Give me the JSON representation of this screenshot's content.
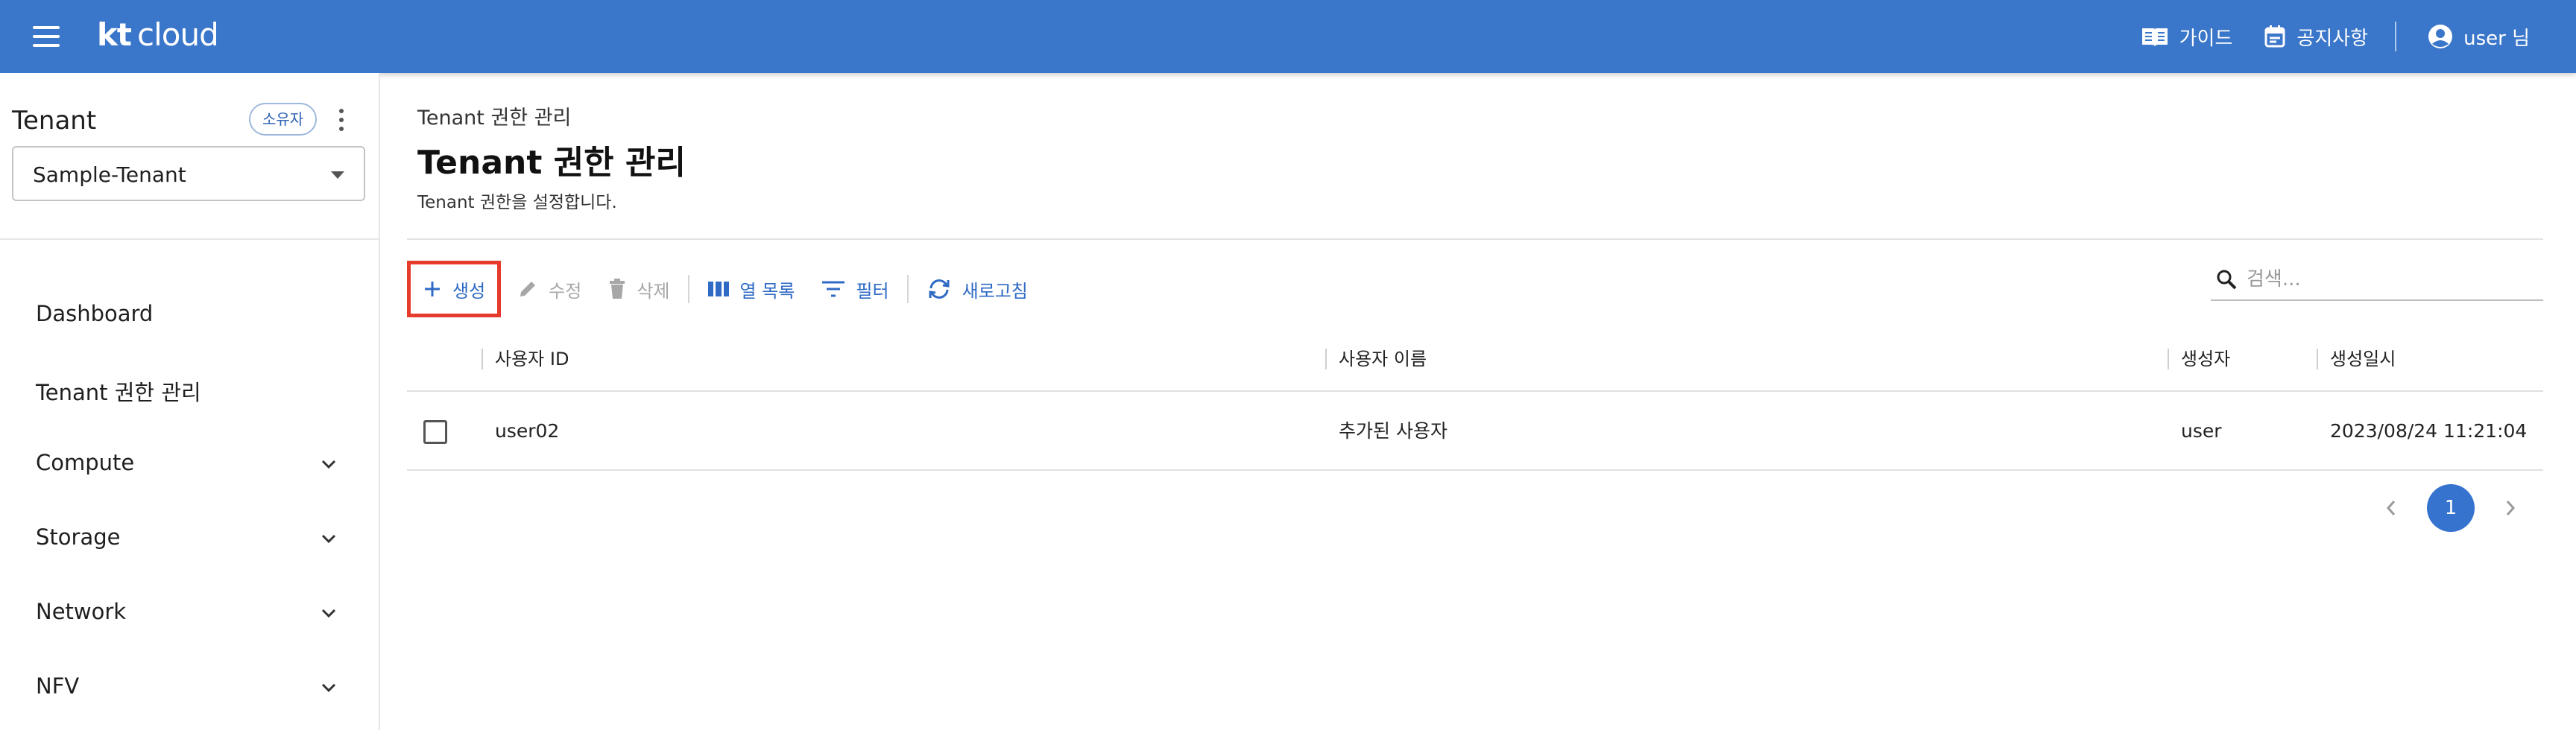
{
  "header": {
    "logo_kt": "kt",
    "logo_cloud": "cloud",
    "guide_label": "가이드",
    "notice_label": "공지사항",
    "user_label": "user 님",
    "bg_color": "#3a76c9"
  },
  "sidebar": {
    "title": "Tenant",
    "owner_badge": "소유자",
    "tenant_selected": "Sample-Tenant",
    "items": [
      {
        "label": "Dashboard",
        "expandable": false
      },
      {
        "label": "Tenant 권한 관리",
        "expandable": false
      },
      {
        "label": "Compute",
        "expandable": true
      },
      {
        "label": "Storage",
        "expandable": true
      },
      {
        "label": "Network",
        "expandable": true
      },
      {
        "label": "NFV",
        "expandable": true
      }
    ]
  },
  "main": {
    "breadcrumb": "Tenant 권한 관리",
    "title": "Tenant 권한 관리",
    "description": "Tenant 권한을 설정합니다.",
    "toolbar": {
      "create": "생성",
      "edit": "수정",
      "delete": "삭제",
      "columns": "열 목록",
      "filter": "필터",
      "refresh": "새로고침"
    },
    "search": {
      "placeholder": "검색..."
    },
    "table": {
      "headers": [
        "사용자 ID",
        "사용자 이름",
        "생성자",
        "생성일시"
      ],
      "rows": [
        {
          "user_id": "user02",
          "user_name": "추가된 사용자",
          "creator": "user",
          "created_at": "2023/08/24 11:21:04"
        }
      ]
    },
    "pagination": {
      "current_page": "1"
    }
  },
  "colors": {
    "accent": "#2f6ac5",
    "highlight_border": "#e53a2c",
    "disabled": "#a7a7a7"
  }
}
